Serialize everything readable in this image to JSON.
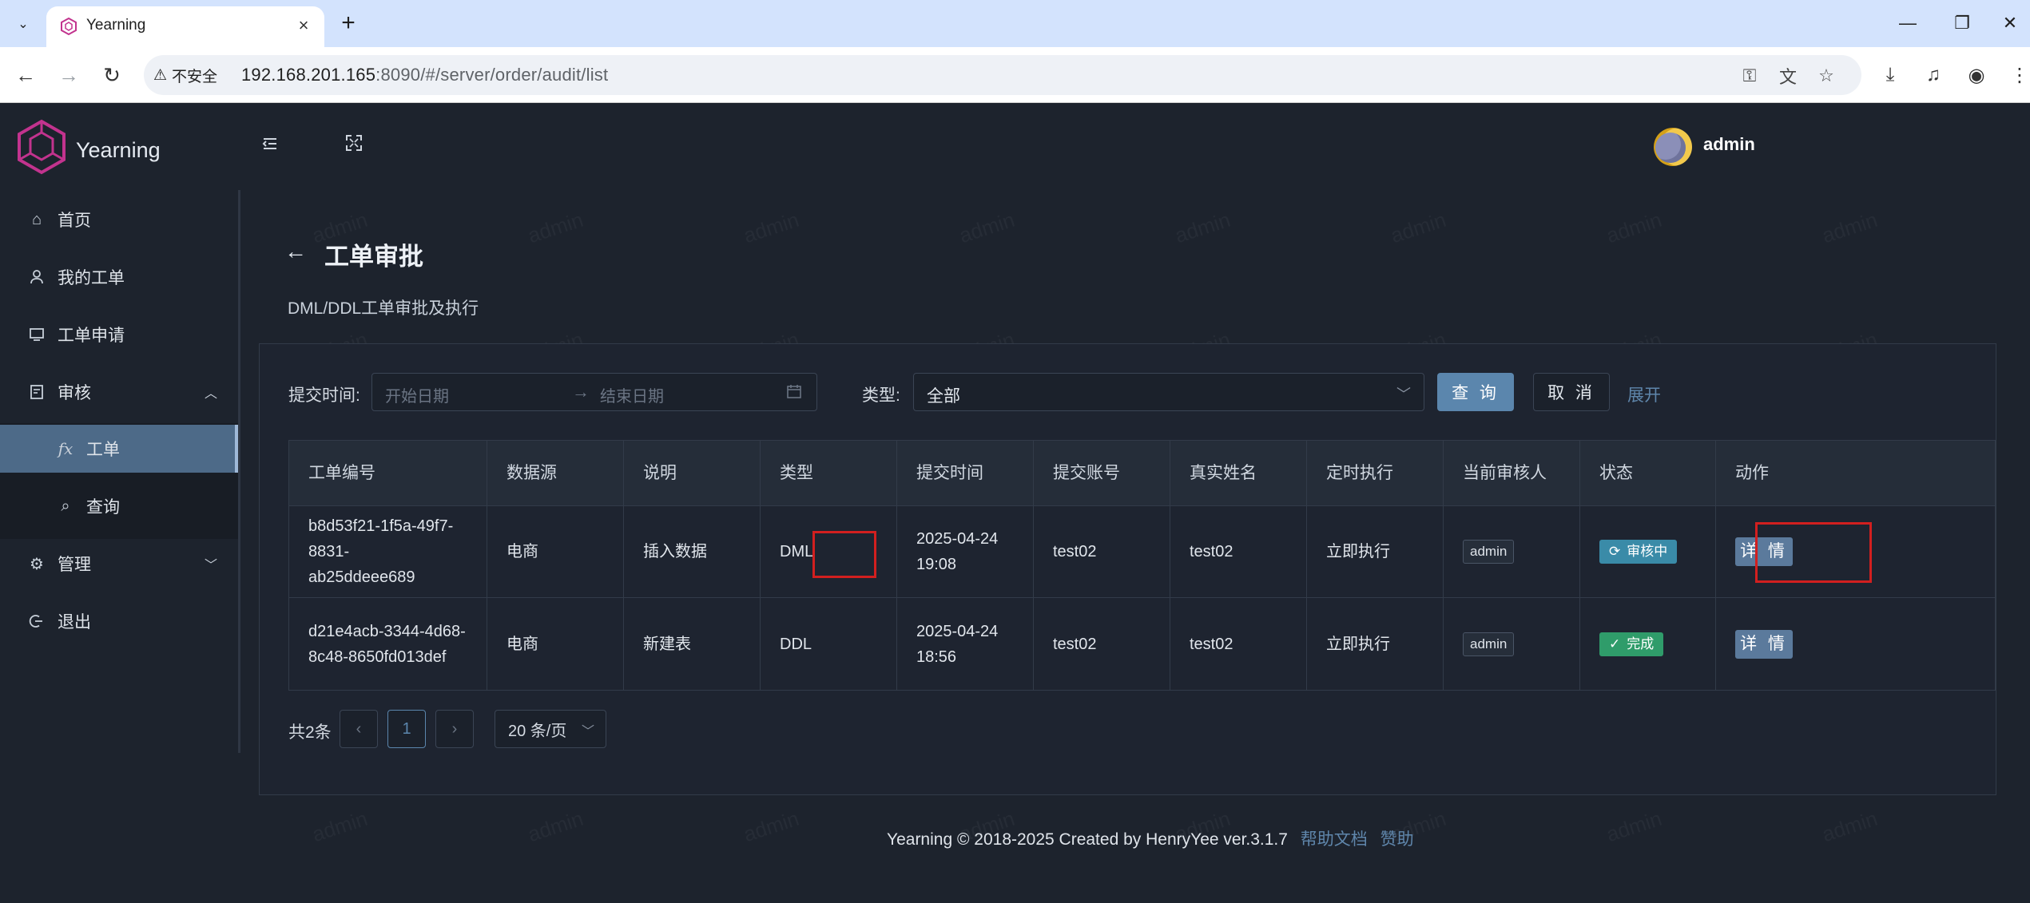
{
  "browser": {
    "tab_title": "Yearning",
    "security_label": "不安全",
    "url_host": "192.168.201.165",
    "url_rest": ":8090/#/server/order/audit/list"
  },
  "app": {
    "brand": "Yearning",
    "username": "admin",
    "accent_color": "#5b86ad",
    "sidebar": {
      "items": [
        {
          "label": "首页",
          "icon": "home-icon"
        },
        {
          "label": "我的工单",
          "icon": "user-icon"
        },
        {
          "label": "工单申请",
          "icon": "monitor-icon"
        },
        {
          "label": "审核",
          "icon": "audit-icon"
        },
        {
          "label": "工单",
          "icon": "function-icon"
        },
        {
          "label": "查询",
          "icon": "search-icon"
        },
        {
          "label": "管理",
          "icon": "settings-icon"
        },
        {
          "label": "退出",
          "icon": "logout-icon"
        }
      ]
    }
  },
  "page": {
    "title": "工单审批",
    "subtitle": "DML/DDL工单审批及执行"
  },
  "filters": {
    "submit_time_label": "提交时间:",
    "start_placeholder": "开始日期",
    "end_placeholder": "结束日期",
    "type_label": "类型:",
    "type_value": "全部",
    "query_label": "查 询",
    "cancel_label": "取 消",
    "expand_label": "展开"
  },
  "table": {
    "columns": [
      "工单编号",
      "数据源",
      "说明",
      "类型",
      "提交时间",
      "提交账号",
      "真实姓名",
      "定时执行",
      "当前审核人",
      "状态",
      "动作"
    ],
    "rows": [
      {
        "id_line1": "b8d53f21-1f5a-49f7-8831-",
        "id_line2": "ab25ddeee689",
        "source": "电商",
        "desc": "插入数据",
        "type": "DML",
        "time_line1": "2025-04-24",
        "time_line2": "19:08",
        "account": "test02",
        "realname": "test02",
        "schedule": "立即执行",
        "auditor": "admin",
        "status": "审核中",
        "action": "详 情"
      },
      {
        "id_line1": "d21e4acb-3344-4d68-",
        "id_line2": "8c48-8650fd013def",
        "source": "电商",
        "desc": "新建表",
        "type": "DDL",
        "time_line1": "2025-04-24",
        "time_line2": "18:56",
        "account": "test02",
        "realname": "test02",
        "schedule": "立即执行",
        "auditor": "admin",
        "status": "完成",
        "action": "详 情"
      }
    ]
  },
  "pagination": {
    "total": "共2条",
    "current_page": "1",
    "page_size": "20 条/页"
  },
  "footer": {
    "text": "Yearning © 2018-2025 Created by HenryYee ver.3.1.7",
    "docs_link": "帮助文档",
    "sponsor_link": "赞助"
  }
}
